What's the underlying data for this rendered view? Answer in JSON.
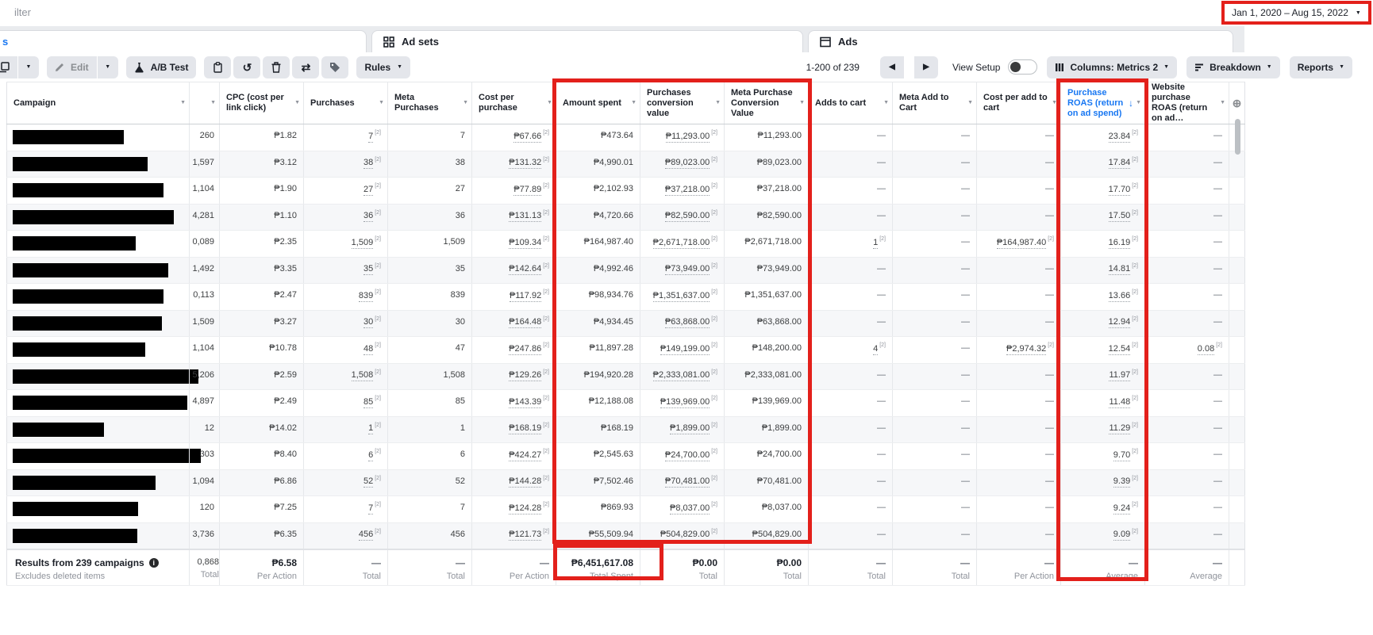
{
  "colors": {
    "highlight_red": "#e3201b",
    "accent_blue": "#1877f2",
    "bar_black": "#000000"
  },
  "icons": {
    "caret_down": "▼",
    "sort_down": "↓",
    "undo": "↺",
    "swap": "⇄",
    "prev": "◀",
    "next": "▶",
    "plus_circle": "⊕",
    "info": "i"
  },
  "topbar": {
    "filter_text": "ilter",
    "date_range": "Jan 1, 2020 – Aug 15, 2022"
  },
  "tabs": {
    "campaigns_partial": "s",
    "ad_sets": "Ad sets",
    "ads": "Ads"
  },
  "toolbar": {
    "edit_label": "Edit",
    "ab_test_label": "A/B Test",
    "rules_label": "Rules",
    "pagination": "1-200 of 239",
    "view_setup_label": "View Setup",
    "columns_label": "Columns: Metrics 2",
    "breakdown_label": "Breakdown",
    "reports_label": "Reports"
  },
  "table": {
    "footnote_marker": "[2]",
    "columns": [
      {
        "key": "campaign",
        "label": "Campaign",
        "link": false
      },
      {
        "key": "col2",
        "label": "",
        "link": false
      },
      {
        "key": "cpc",
        "label": "CPC (cost per link click)",
        "link": false
      },
      {
        "key": "purchases",
        "label": "Purchases",
        "link": true
      },
      {
        "key": "meta_purchases",
        "label": "Meta Purchases",
        "link": false
      },
      {
        "key": "cpp",
        "label": "Cost per purchase",
        "link": true
      },
      {
        "key": "spent",
        "label": "Amount spent",
        "link": false
      },
      {
        "key": "conv",
        "label": "Purchases conversion value",
        "link": true
      },
      {
        "key": "meta_conv",
        "label": "Meta Purchase Conversion Value",
        "link": false
      },
      {
        "key": "atc",
        "label": "Adds to cart",
        "link": true
      },
      {
        "key": "meta_atc",
        "label": "Meta Add to Cart",
        "link": false
      },
      {
        "key": "cpatc",
        "label": "Cost per add to cart",
        "link": true
      },
      {
        "key": "roas",
        "label": "Purchase ROAS (return on ad spend)",
        "link": true,
        "sorted": true,
        "color": "#1877f2"
      },
      {
        "key": "web_roas",
        "label": "Website purchase ROAS (return on ad…",
        "link": true
      }
    ],
    "rows": [
      {
        "bar": 140,
        "col2": "260",
        "cpc": "₱1.82",
        "purchases": "7",
        "meta_purchases": "7",
        "cpp": "₱67.66",
        "spent": "₱473.64",
        "conv": "₱11,293.00",
        "meta_conv": "₱11,293.00",
        "atc": "—",
        "meta_atc": "—",
        "cpatc": "—",
        "roas": "23.84",
        "web_roas": "—"
      },
      {
        "bar": 170,
        "col2": "1,597",
        "cpc": "₱3.12",
        "purchases": "38",
        "meta_purchases": "38",
        "cpp": "₱131.32",
        "spent": "₱4,990.01",
        "conv": "₱89,023.00",
        "meta_conv": "₱89,023.00",
        "atc": "—",
        "meta_atc": "—",
        "cpatc": "—",
        "roas": "17.84",
        "web_roas": "—"
      },
      {
        "bar": 190,
        "col2": "1,104",
        "cpc": "₱1.90",
        "purchases": "27",
        "meta_purchases": "27",
        "cpp": "₱77.89",
        "spent": "₱2,102.93",
        "conv": "₱37,218.00",
        "meta_conv": "₱37,218.00",
        "atc": "—",
        "meta_atc": "—",
        "cpatc": "—",
        "roas": "17.70",
        "web_roas": "—"
      },
      {
        "bar": 203,
        "col2": "4,281",
        "cpc": "₱1.10",
        "purchases": "36",
        "meta_purchases": "36",
        "cpp": "₱131.13",
        "spent": "₱4,720.66",
        "conv": "₱82,590.00",
        "meta_conv": "₱82,590.00",
        "atc": "—",
        "meta_atc": "—",
        "cpatc": "—",
        "roas": "17.50",
        "web_roas": "—"
      },
      {
        "bar": 155,
        "col2": "0,089",
        "cpc": "₱2.35",
        "purchases": "1,509",
        "meta_purchases": "1,509",
        "cpp": "₱109.34",
        "spent": "₱164,987.40",
        "conv": "₱2,671,718.00",
        "meta_conv": "₱2,671,718.00",
        "atc": "1",
        "meta_atc": "—",
        "cpatc": "₱164,987.40",
        "roas": "16.19",
        "web_roas": "—"
      },
      {
        "bar": 196,
        "col2": "1,492",
        "cpc": "₱3.35",
        "purchases": "35",
        "meta_purchases": "35",
        "cpp": "₱142.64",
        "spent": "₱4,992.46",
        "conv": "₱73,949.00",
        "meta_conv": "₱73,949.00",
        "atc": "—",
        "meta_atc": "—",
        "cpatc": "—",
        "roas": "14.81",
        "web_roas": "—"
      },
      {
        "bar": 190,
        "col2": "0,113",
        "cpc": "₱2.47",
        "purchases": "839",
        "meta_purchases": "839",
        "cpp": "₱117.92",
        "spent": "₱98,934.76",
        "conv": "₱1,351,637.00",
        "meta_conv": "₱1,351,637.00",
        "atc": "—",
        "meta_atc": "—",
        "cpatc": "—",
        "roas": "13.66",
        "web_roas": "—"
      },
      {
        "bar": 188,
        "col2": "1,509",
        "cpc": "₱3.27",
        "purchases": "30",
        "meta_purchases": "30",
        "cpp": "₱164.48",
        "spent": "₱4,934.45",
        "conv": "₱63,868.00",
        "meta_conv": "₱63,868.00",
        "atc": "—",
        "meta_atc": "—",
        "cpatc": "—",
        "roas": "12.94",
        "web_roas": "—"
      },
      {
        "bar": 167,
        "col2": "1,104",
        "cpc": "₱10.78",
        "purchases": "48",
        "meta_purchases": "47",
        "cpp": "₱247.86",
        "spent": "₱11,897.28",
        "conv": "₱149,199.00",
        "meta_conv": "₱148,200.00",
        "atc": "4",
        "meta_atc": "—",
        "cpatc": "₱2,974.32",
        "roas": "12.54",
        "web_roas": "0.08"
      },
      {
        "bar": 234,
        "col2": "5,206",
        "cpc": "₱2.59",
        "purchases": "1,508",
        "meta_purchases": "1,508",
        "cpp": "₱129.26",
        "spent": "₱194,920.28",
        "conv": "₱2,333,081.00",
        "meta_conv": "₱2,333,081.00",
        "atc": "—",
        "meta_atc": "—",
        "cpatc": "—",
        "roas": "11.97",
        "web_roas": "—"
      },
      {
        "bar": 220,
        "col2": "4,897",
        "cpc": "₱2.49",
        "purchases": "85",
        "meta_purchases": "85",
        "cpp": "₱143.39",
        "spent": "₱12,188.08",
        "conv": "₱139,969.00",
        "meta_conv": "₱139,969.00",
        "atc": "—",
        "meta_atc": "—",
        "cpatc": "—",
        "roas": "11.48",
        "web_roas": "—"
      },
      {
        "bar": 115,
        "col2": "12",
        "cpc": "₱14.02",
        "purchases": "1",
        "meta_purchases": "1",
        "cpp": "₱168.19",
        "spent": "₱168.19",
        "conv": "₱1,899.00",
        "meta_conv": "₱1,899.00",
        "atc": "—",
        "meta_atc": "—",
        "cpatc": "—",
        "roas": "11.29",
        "web_roas": "—"
      },
      {
        "bar": 237,
        "col2": "303",
        "cpc": "₱8.40",
        "purchases": "6",
        "meta_purchases": "6",
        "cpp": "₱424.27",
        "spent": "₱2,545.63",
        "conv": "₱24,700.00",
        "meta_conv": "₱24,700.00",
        "atc": "—",
        "meta_atc": "—",
        "cpatc": "—",
        "roas": "9.70",
        "web_roas": "—"
      },
      {
        "bar": 180,
        "col2": "1,094",
        "cpc": "₱6.86",
        "purchases": "52",
        "meta_purchases": "52",
        "cpp": "₱144.28",
        "spent": "₱7,502.46",
        "conv": "₱70,481.00",
        "meta_conv": "₱70,481.00",
        "atc": "—",
        "meta_atc": "—",
        "cpatc": "—",
        "roas": "9.39",
        "web_roas": "—"
      },
      {
        "bar": 158,
        "col2": "120",
        "cpc": "₱7.25",
        "purchases": "7",
        "meta_purchases": "7",
        "cpp": "₱124.28",
        "spent": "₱869.93",
        "conv": "₱8,037.00",
        "meta_conv": "₱8,037.00",
        "atc": "—",
        "meta_atc": "—",
        "cpatc": "—",
        "roas": "9.24",
        "web_roas": "—"
      },
      {
        "bar": 157,
        "col2": "3,736",
        "cpc": "₱6.35",
        "purchases": "456",
        "meta_purchases": "456",
        "cpp": "₱121.73",
        "spent": "₱55,509.94",
        "conv": "₱504,829.00",
        "meta_conv": "₱504,829.00",
        "atc": "—",
        "meta_atc": "—",
        "cpatc": "—",
        "roas": "9.09",
        "web_roas": "—"
      }
    ],
    "totals": {
      "label": "Results from 239 campaigns",
      "sublabel": "Excludes deleted items",
      "cells": {
        "col2": {
          "v": "0,868",
          "sub": "Total"
        },
        "cpc": {
          "v": "₱6.58",
          "sub": "Per Action"
        },
        "purchases": {
          "v": "—",
          "sub": "Total"
        },
        "meta_purchases": {
          "v": "—",
          "sub": "Total"
        },
        "cpp": {
          "v": "—",
          "sub": "Per Action"
        },
        "spent": {
          "v": "₱6,451,617.08",
          "sub": "Total Spent"
        },
        "conv": {
          "v": "₱0.00",
          "sub": "Total"
        },
        "meta_conv": {
          "v": "₱0.00",
          "sub": "Total"
        },
        "atc": {
          "v": "—",
          "sub": "Total"
        },
        "meta_atc": {
          "v": "—",
          "sub": "Total"
        },
        "cpatc": {
          "v": "—",
          "sub": "Per Action"
        },
        "roas": {
          "v": "—",
          "sub": "Average"
        },
        "web_roas": {
          "v": "—",
          "sub": "Average"
        }
      }
    }
  }
}
